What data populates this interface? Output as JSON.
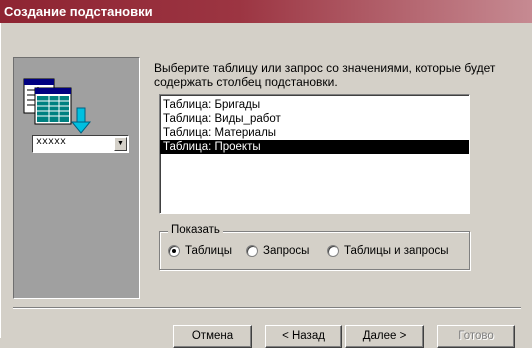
{
  "window": {
    "title": "Создание подстановки"
  },
  "illustration": {
    "icon": "table-lookup-icon",
    "combo_text": "ххххх"
  },
  "instruction": "Выберите таблицу или запрос со значениями, которые будет содержать столбец подстановки.",
  "list": {
    "items": [
      "Таблица: Бригады",
      "Таблица: Виды_работ",
      "Таблица: Материалы",
      "Таблица: Проекты"
    ],
    "selected_index": 3
  },
  "show_group": {
    "title": "Показать",
    "options": [
      "Таблицы",
      "Запросы",
      "Таблицы и запросы"
    ],
    "selected_index": 0
  },
  "buttons": {
    "cancel": "Отмена",
    "back": "< Назад",
    "next": "Далее >",
    "finish": "Готово"
  },
  "colors": {
    "title_bar": "#8e2432",
    "selection": "#000000",
    "face": "#d4d0c8"
  }
}
